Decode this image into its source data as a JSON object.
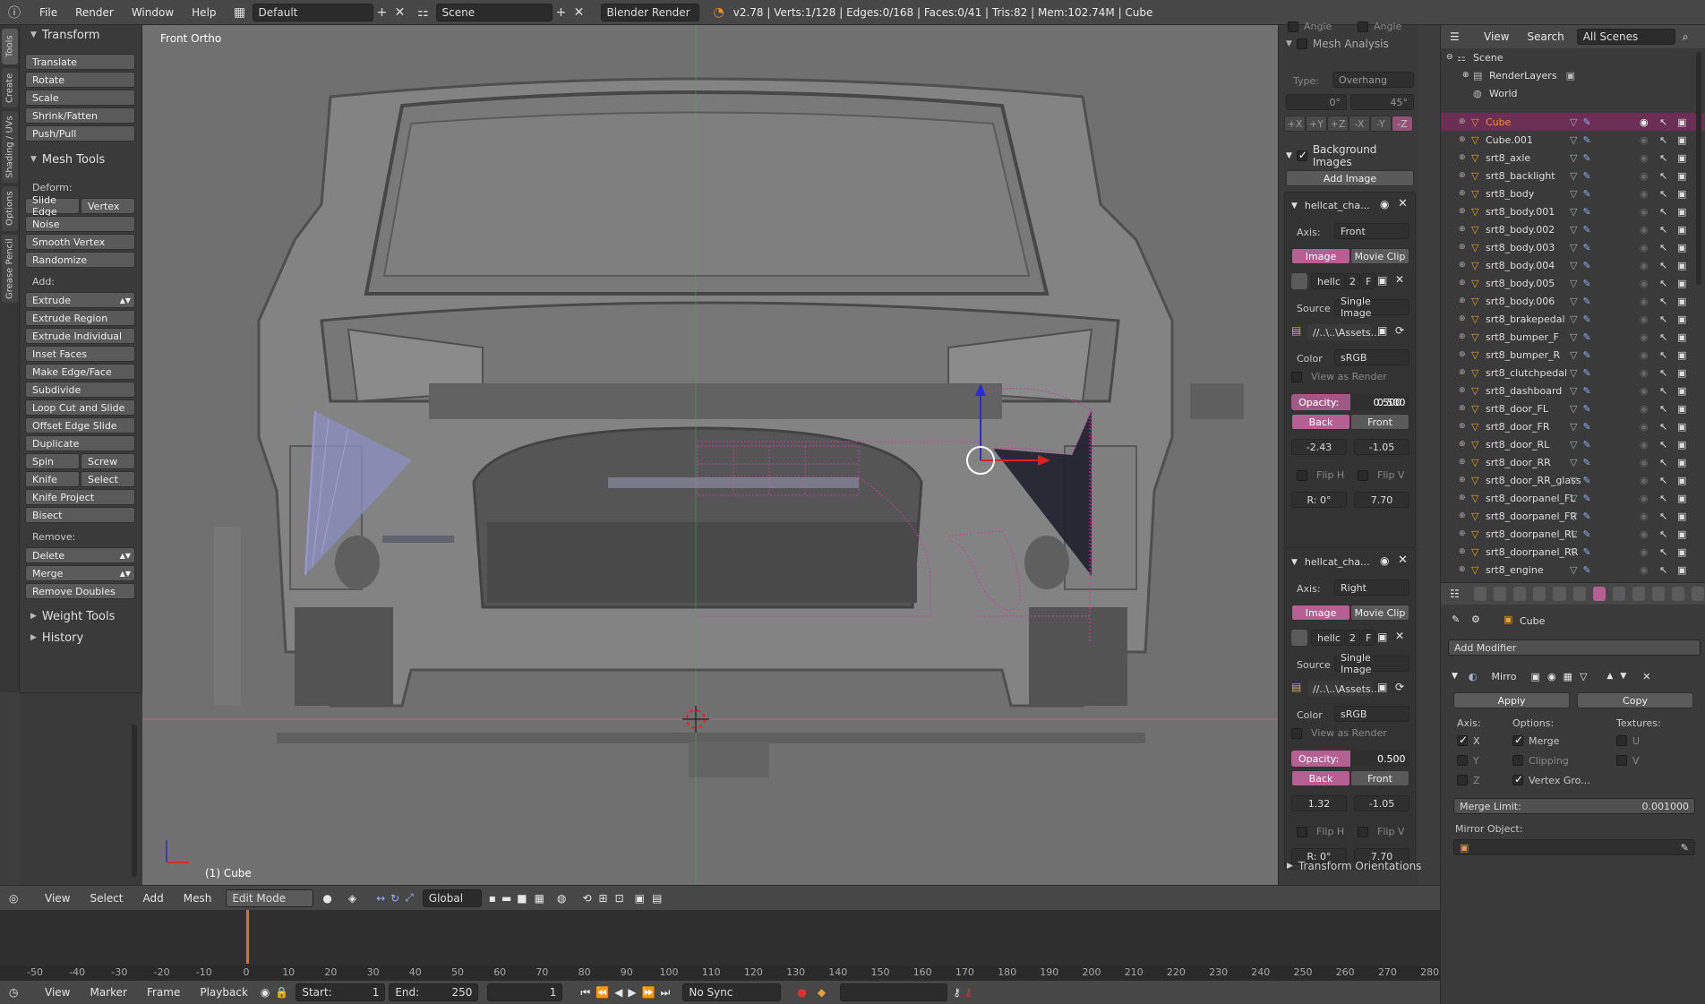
{
  "topbar": {
    "menus": [
      "File",
      "Render",
      "Window",
      "Help"
    ],
    "layout": "Default",
    "scene": "Scene",
    "engine": "Blender Render",
    "stats": "v2.78 | Verts:1/128 | Edges:0/168 | Faces:0/41 | Tris:82 | Mem:102.74M | Cube"
  },
  "tabstrip": [
    "Tools",
    "Create",
    "Shading / UVs",
    "Options",
    "Grease Pencil"
  ],
  "toolshelf": {
    "transform_title": "Transform",
    "transform": [
      "Translate",
      "Rotate",
      "Scale",
      "Shrink/Fatten",
      "Push/Pull"
    ],
    "meshtools_title": "Mesh Tools",
    "deform_label": "Deform:",
    "slide_edge": "Slide Edge",
    "vertex": "Vertex",
    "deform": [
      "Noise",
      "Smooth Vertex",
      "Randomize"
    ],
    "add_label": "Add:",
    "add": [
      "Extrude",
      "Extrude Region",
      "Extrude Individual",
      "Inset Faces",
      "Make Edge/Face",
      "Subdivide",
      "Loop Cut and Slide",
      "Offset Edge Slide",
      "Duplicate"
    ],
    "spin": "Spin",
    "screw": "Screw",
    "knife": "Knife",
    "select": "Select",
    "knife_project": "Knife Project",
    "bisect": "Bisect",
    "remove_label": "Remove:",
    "delete": "Delete",
    "merge": "Merge",
    "remove_doubles": "Remove Doubles",
    "weight_tools": "Weight Tools",
    "history": "History"
  },
  "viewport": {
    "view_name": "Front Ortho",
    "object_label": "(1) Cube"
  },
  "npanel": {
    "angle_a": "Angle",
    "angle_b": "Angle",
    "mesh_analysis": "Mesh Analysis",
    "type_label": "Type:",
    "type_value": "Overhang",
    "min_angle": "0°",
    "max_angle": "45°",
    "axes": [
      "+X",
      "+Y",
      "+Z",
      "-X",
      "-Y",
      "-Z"
    ],
    "background_images": "Background Images",
    "add_image": "Add Image",
    "bg1": {
      "name": "hellcat_cha...",
      "axis_label": "Axis:",
      "axis": "Front",
      "tab_image": "Image",
      "tab_movie": "Movie Clip",
      "img_name": "hellc",
      "img_users": "2",
      "img_f": "F",
      "source_label": "Source",
      "source": "Single Image",
      "path": "//..\\..\\Assets...",
      "color_label": "Color",
      "color": "sRGB",
      "view_as_render": "View as Render",
      "opacity_label": "Opacity:",
      "opacity": "0.500",
      "back": "Back",
      "front": "Front",
      "offset_x": "-2.43",
      "offset_y": "-1.05",
      "flip_h": "Flip H",
      "flip_v": "Flip V",
      "rotation": "R: 0°",
      "size": "7.70"
    },
    "bg2": {
      "name": "hellcat_cha...",
      "axis_label": "Axis:",
      "axis": "Right",
      "tab_image": "Image",
      "tab_movie": "Movie Clip",
      "img_name": "hellc",
      "img_users": "2",
      "img_f": "F",
      "source_label": "Source",
      "source": "Single Image",
      "path": "//..\\..\\Assets...",
      "color_label": "Color",
      "color": "sRGB",
      "view_as_render": "View as Render",
      "opacity_label": "Opacity:",
      "opacity": "0.500",
      "back": "Back",
      "front": "Front",
      "offset_x": "1.32",
      "offset_y": "-1.05",
      "flip_h": "Flip H",
      "flip_v": "Flip V",
      "rotation": "R: 0°",
      "size": "7.70"
    },
    "transform_orientations": "Transform Orientations"
  },
  "outliner": {
    "menus": [
      "View",
      "Search"
    ],
    "filter": "All Scenes",
    "scene": "Scene",
    "renderlayers": "RenderLayers",
    "world": "World",
    "objects": [
      "Cube",
      "Cube.001",
      "srt8_axle",
      "srt8_backlight",
      "srt8_body",
      "srt8_body.001",
      "srt8_body.002",
      "srt8_body.003",
      "srt8_body.004",
      "srt8_body.005",
      "srt8_body.006",
      "srt8_brakepedal",
      "srt8_bumper_F",
      "srt8_bumper_R",
      "srt8_clutchpedal",
      "srt8_dashboard",
      "srt8_door_FL",
      "srt8_door_FR",
      "srt8_door_RL",
      "srt8_door_RR",
      "srt8_door_RR_glass",
      "srt8_doorpanel_FL",
      "srt8_doorpanel_FR",
      "srt8_doorpanel_RL",
      "srt8_doorpanel_RR",
      "srt8_engine"
    ]
  },
  "props": {
    "object": "Cube",
    "add_modifier": "Add Modifier",
    "modifier_name": "Mirro",
    "apply": "Apply",
    "copy": "Copy",
    "axis_label": "Axis:",
    "options_label": "Options:",
    "textures_label": "Textures:",
    "x": "X",
    "y": "Y",
    "z": "Z",
    "merge": "Merge",
    "clipping": "Clipping",
    "vertex_groups": "Vertex Gro...",
    "u": "U",
    "v": "V",
    "merge_limit_label": "Merge Limit:",
    "merge_limit": "0.001000",
    "mirror_object": "Mirror Object:"
  },
  "vheader": {
    "menus": [
      "View",
      "Select",
      "Add",
      "Mesh"
    ],
    "mode": "Edit Mode",
    "orientation": "Global"
  },
  "timeline": {
    "ticks": [
      "-50",
      "-40",
      "-30",
      "-20",
      "-10",
      "0",
      "10",
      "20",
      "30",
      "40",
      "50",
      "60",
      "70",
      "80",
      "90",
      "100",
      "110",
      "120",
      "130",
      "140",
      "150",
      "160",
      "170",
      "180",
      "190",
      "200",
      "210",
      "220",
      "230",
      "240",
      "250",
      "260",
      "270",
      "280"
    ],
    "menus": [
      "View",
      "Marker",
      "Frame",
      "Playback"
    ],
    "start_label": "Start:",
    "start": "1",
    "end_label": "End:",
    "end": "250",
    "current": "1",
    "sync": "No Sync"
  },
  "colors": {
    "accent": "#b65f93",
    "selected_row": "#6b2f56",
    "cube_text": "#ff8c3a"
  }
}
